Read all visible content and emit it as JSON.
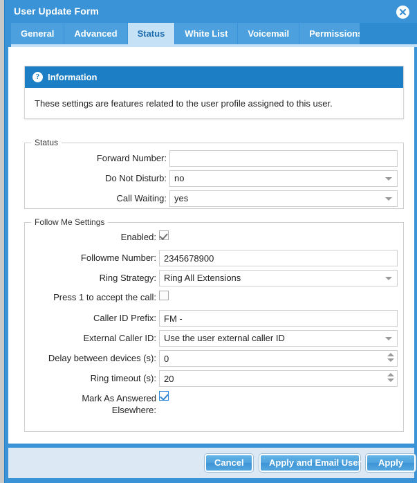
{
  "window": {
    "title": "User Update Form",
    "close_icon": "close-icon"
  },
  "tabs": [
    {
      "label": "General",
      "active": false
    },
    {
      "label": "Advanced",
      "active": false
    },
    {
      "label": "Status",
      "active": true
    },
    {
      "label": "White List",
      "active": false
    },
    {
      "label": "Voicemail",
      "active": false
    },
    {
      "label": "Permissions",
      "active": false
    }
  ],
  "info": {
    "icon": "question-mark-icon",
    "heading": "Information",
    "text": "These settings are features related to the user profile assigned to this user."
  },
  "status_section": {
    "legend": "Status",
    "fields": {
      "forward_number_label": "Forward Number:",
      "forward_number_value": "",
      "forward_number_placeholder": "",
      "do_not_disturb_label": "Do Not Disturb:",
      "do_not_disturb_value": "no",
      "call_waiting_label": "Call Waiting:",
      "call_waiting_value": "yes"
    }
  },
  "follow_me_section": {
    "legend": "Follow Me Settings",
    "fields": {
      "enabled_label": "Enabled:",
      "enabled_checked": "true",
      "followme_number_label": "Followme Number:",
      "followme_number_value": "2345678900",
      "ring_strategy_label": "Ring Strategy:",
      "ring_strategy_value": "Ring All Extensions",
      "press1_label": "Press 1 to accept the call:",
      "press1_checked": "false",
      "caller_id_prefix_label": "Caller ID Prefix:",
      "caller_id_prefix_value": "FM -",
      "external_caller_id_label": "External Caller ID:",
      "external_caller_id_value": "Use the user external caller ID",
      "delay_label": "Delay between devices (s):",
      "delay_value": "0",
      "ring_timeout_label": "Ring timeout (s):",
      "ring_timeout_value": "20",
      "mark_answered_label_line1": "Mark As Answered",
      "mark_answered_label_line2": "Elsewhere:",
      "mark_answered_checked": "true"
    }
  },
  "footer": {
    "cancel_label": "Cancel",
    "apply_email_label": "Apply and Email User",
    "apply_label": "Apply"
  },
  "colors": {
    "accent": "#3a93d6",
    "info_header": "#1c7ec4",
    "active_tab_bg": "#c5e1f5",
    "active_tab_text": "#1f6eb0",
    "footer_bg": "#dce9f5"
  }
}
